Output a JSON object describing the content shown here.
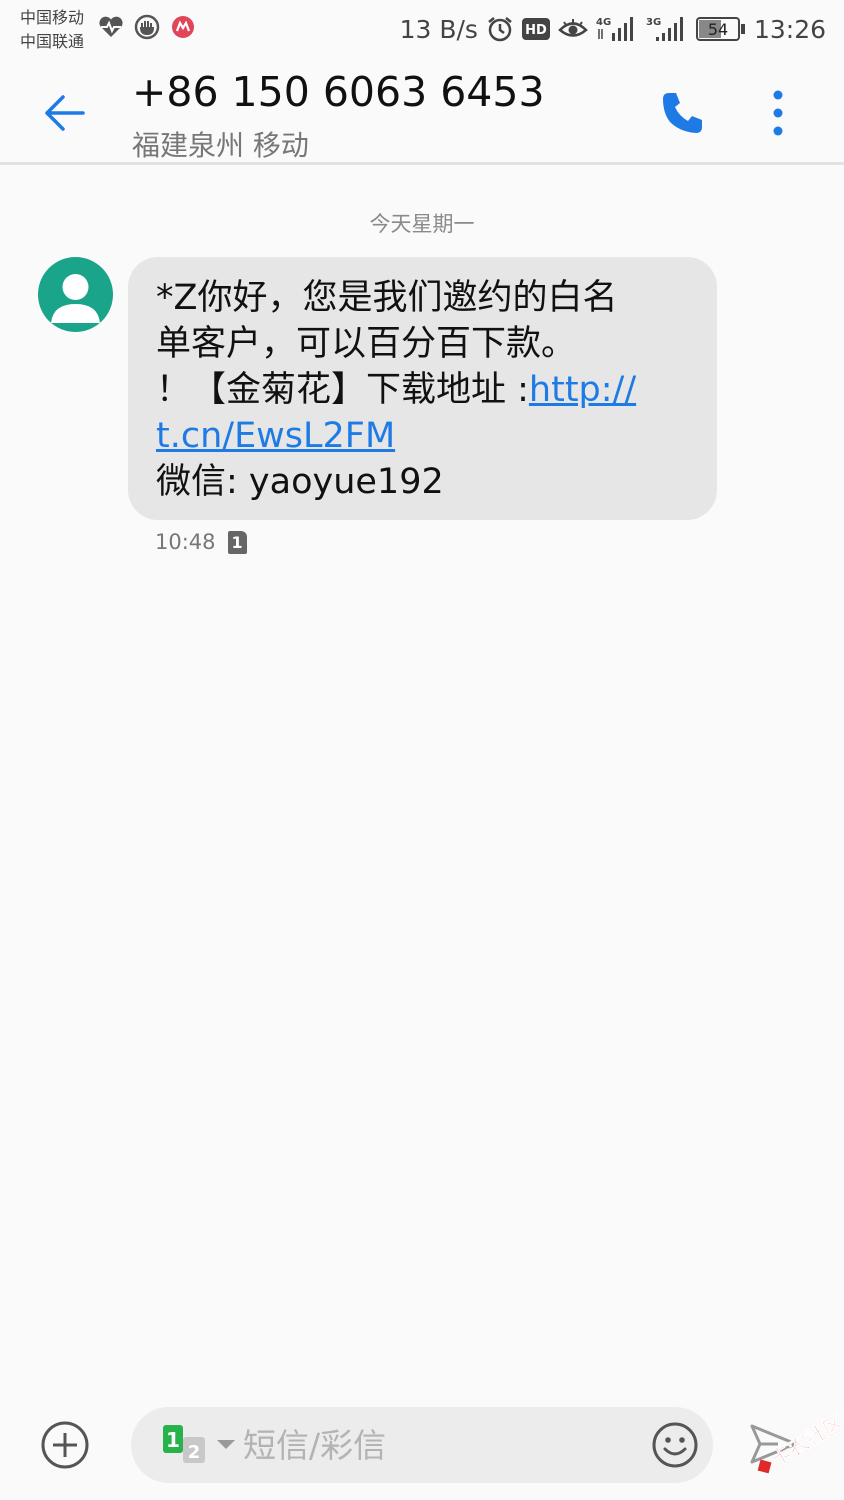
{
  "status_bar": {
    "carrier_1": "中国移动",
    "carrier_2": "中国联通",
    "net_speed": "13 B/s",
    "hd_label": "HD",
    "signal_1_type": "4G",
    "signal_2_type": "3G",
    "battery_level": "54",
    "time": "13:26",
    "icons": [
      "health-icon",
      "shield-icon",
      "bank-icon",
      "alarm-icon",
      "hd-icon",
      "eye-icon",
      "signal-4g-icon",
      "signal-3g-icon",
      "battery-icon"
    ]
  },
  "header": {
    "contact_number": "+86 150 6063 6453",
    "contact_location": "福建泉州 移动",
    "icons": [
      "back-arrow-icon",
      "phone-icon",
      "more-vertical-icon"
    ]
  },
  "conversation": {
    "date_separator": "今天星期一",
    "message": {
      "line1": "*Z你好，您是我们邀约的白名",
      "line2": "单客户，可以百分百下款。",
      "line3_text": "！【金菊花】下载地址 :",
      "link_part1": "http://",
      "link_part2": "t.cn/EwsL2FM",
      "line5": "微信: yaoyue192",
      "time": "10:48",
      "sim_label": "1"
    }
  },
  "input_bar": {
    "placeholder": "短信/彩信",
    "sim_primary": "1",
    "sim_secondary": "2",
    "icons": [
      "add-circle-icon",
      "sim-select-icon",
      "emoji-icon",
      "send-icon"
    ]
  },
  "watermark": {
    "text": "卡农社区"
  },
  "colors": {
    "accent_blue": "#1e7be6",
    "avatar_green": "#1aa58a",
    "bubble_bg": "#e6e6e6",
    "page_bg": "#fafafa",
    "sim_green": "#27b24a"
  }
}
